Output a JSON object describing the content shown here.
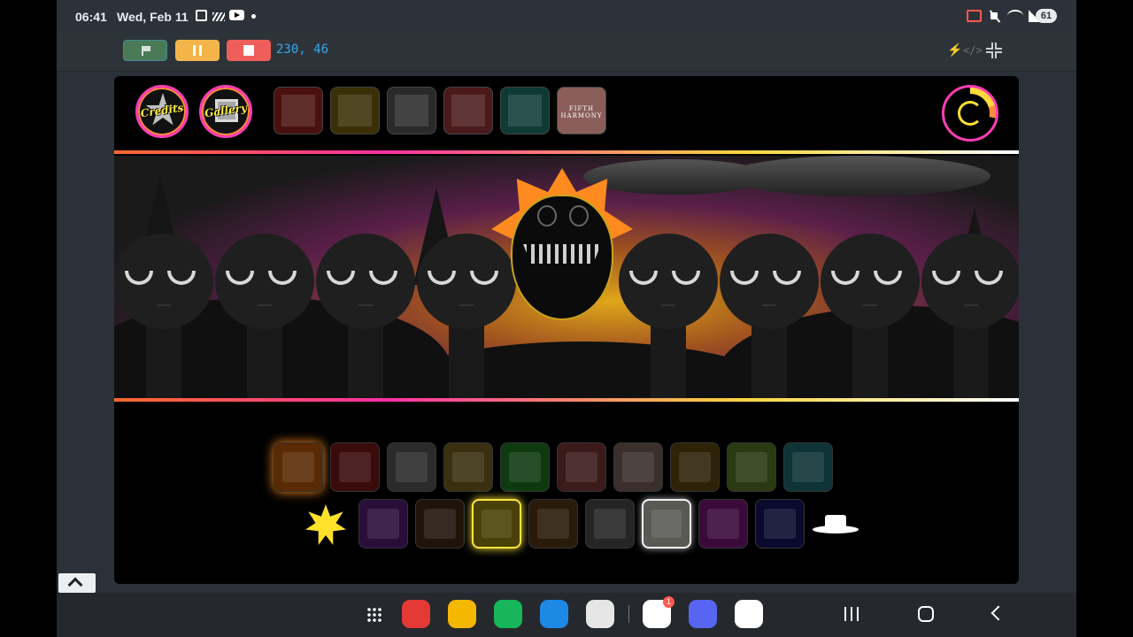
{
  "status_bar": {
    "time": "06:41",
    "date": "Wed, Feb 11",
    "battery": "61",
    "icons": [
      "screenshot-icon",
      "signal-slash-icon",
      "youtube-icon",
      "notification-dot-icon",
      "cast-icon",
      "mute-icon",
      "wifi-icon",
      "cell-signal-icon",
      "battery-icon"
    ]
  },
  "controls": {
    "buttons": [
      {
        "name": "green-flag",
        "color": "#4b7a59"
      },
      {
        "name": "pause",
        "color": "#f3b54a"
      },
      {
        "name": "stop",
        "color": "#ef5e5a"
      }
    ],
    "coordinates": "230, 46",
    "coordinates_color": "#39a6e6",
    "right_icons": [
      "turbo-bolt-icon",
      "code-icon",
      "exit-fullscreen-icon"
    ]
  },
  "game": {
    "top_buttons": [
      {
        "label": "Credits",
        "icon": "star-icon"
      },
      {
        "label": "Gallery",
        "icon": "picture-frame-icon"
      }
    ],
    "bonus_icons": [
      {
        "name": "cone-bonus-icon",
        "color": "#4a1010"
      },
      {
        "name": "wedge-bonus-icon",
        "color": "#3a2f05"
      },
      {
        "name": "dome-bonus-icon",
        "color": "#2a2a2a"
      },
      {
        "name": "crown-bonus-icon",
        "color": "#4a1a1a"
      },
      {
        "name": "bolt-bonus-icon",
        "color": "#0e3a36"
      },
      {
        "name": "fifth-harmony-bonus-icon",
        "color": "#8a5e5a",
        "text": "FIFTH HARMONY"
      }
    ],
    "reset_icon": "reset-icon",
    "singer_count": 8,
    "accent_colors": {
      "orange": "#ff6a2a",
      "pink": "#ff2fa6",
      "yellow": "#ffd83d"
    },
    "sound_row_1": [
      {
        "name": "sound-orange-mouth-icon",
        "color": "#5a2a05"
      },
      {
        "name": "sound-red-machine-icon",
        "color": "#3a0b0b"
      },
      {
        "name": "sound-grey-slash-icon",
        "color": "#2b2b2b"
      },
      {
        "name": "sound-monitor-icon",
        "color": "#3a3010"
      },
      {
        "name": "sound-green-swirl-icon",
        "color": "#0f3a10"
      },
      {
        "name": "sound-red-stick-icon",
        "color": "#3b1a1a"
      },
      {
        "name": "sound-tan-block-icon",
        "color": "#3a2f2a"
      },
      {
        "name": "sound-gold-visor-icon",
        "color": "#2e2208"
      },
      {
        "name": "sound-green-grass-icon",
        "color": "#2a3a12"
      },
      {
        "name": "sound-teal-hat-icon",
        "color": "#0e3437"
      }
    ],
    "sound_row_2": [
      {
        "name": "sound-purple-crown-icon",
        "color": "#2a0e3a"
      },
      {
        "name": "sound-dark-cone-icon",
        "color": "#20140a"
      },
      {
        "name": "sound-yellow-arrows-icon",
        "color": "#4a4108",
        "state": "selected"
      },
      {
        "name": "sound-brown-dome-icon",
        "color": "#2a1a0a"
      },
      {
        "name": "sound-grey-monitor-icon",
        "color": "#252525"
      },
      {
        "name": "sound-envelope-icon",
        "color": "#5a5a55",
        "state": "selected-white"
      },
      {
        "name": "sound-magenta-chair-icon",
        "color": "#3a0a3a"
      },
      {
        "name": "sound-blue-shadow-icon",
        "color": "#0a0a2e"
      }
    ],
    "extra_icons": [
      "sun-icon",
      "white-hat-icon"
    ]
  },
  "navbar": {
    "apps": [
      {
        "name": "app-drawer-icon"
      },
      {
        "name": "notes-app-icon",
        "color": "#e53935"
      },
      {
        "name": "files-app-icon",
        "color": "#f5b800"
      },
      {
        "name": "phone-app-icon",
        "color": "#18b65a"
      },
      {
        "name": "messages-app-icon",
        "color": "#1e88e5"
      },
      {
        "name": "camera-app-icon",
        "color": "#e6e6e6"
      },
      {
        "name": "google-app-icon",
        "color": "#ffffff",
        "badge": "1"
      },
      {
        "name": "discord-app-icon",
        "color": "#5865f2"
      },
      {
        "name": "gmail-app-icon",
        "color": "#ffffff"
      }
    ],
    "nav_buttons": [
      "recents-button",
      "home-button",
      "back-button"
    ]
  }
}
